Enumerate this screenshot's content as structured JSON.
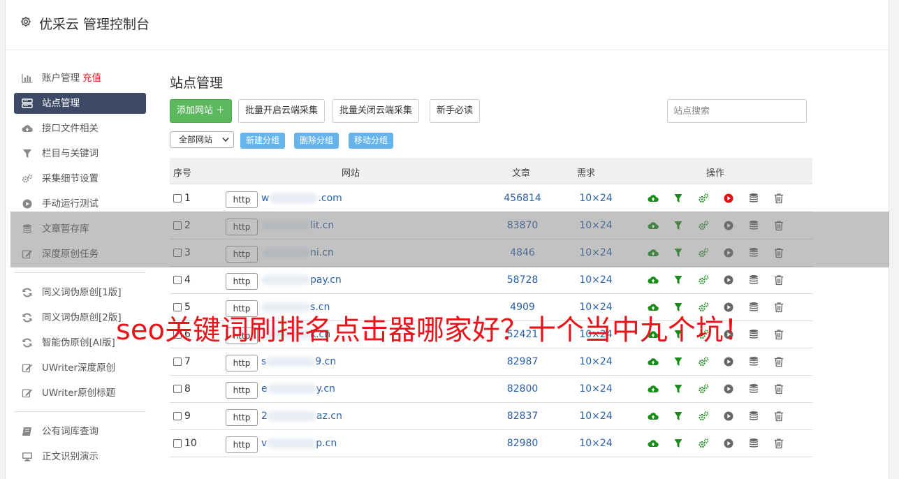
{
  "app": {
    "title": "优采云 管理控制台"
  },
  "sidebar": {
    "group1": [
      {
        "label": "账户管理",
        "extra": "充值",
        "icon": "bar-chart-icon"
      },
      {
        "label": "站点管理",
        "icon": "server-icon",
        "active": true
      },
      {
        "label": "接口文件相关",
        "icon": "cloud-upload-icon"
      },
      {
        "label": "栏目与关键词",
        "icon": "filter-icon"
      },
      {
        "label": "采集细节设置",
        "icon": "gears-icon"
      },
      {
        "label": "手动运行测试",
        "icon": "play-circle-icon"
      },
      {
        "label": "文章暂存库",
        "icon": "database-icon"
      },
      {
        "label": "深度原创任务",
        "icon": "edit-icon"
      }
    ],
    "group2": [
      {
        "label": "同义词伪原创[1版]",
        "icon": "refresh-icon"
      },
      {
        "label": "同义词伪原创[2版]",
        "icon": "refresh-icon"
      },
      {
        "label": "智能伪原创[AI版]",
        "icon": "refresh-icon"
      },
      {
        "label": "UWriter深度原创",
        "icon": "edit-icon"
      },
      {
        "label": "UWriter原创标题",
        "icon": "edit-icon"
      }
    ],
    "group3": [
      {
        "label": "公有词库查询",
        "icon": "book-icon"
      },
      {
        "label": "正文识别演示",
        "icon": "monitor-icon"
      }
    ]
  },
  "main": {
    "title": "站点管理",
    "buttons": {
      "add_site": "添加网站 ＋",
      "batch_open": "批量开启云端采集",
      "batch_close": "批量关闭云端采集",
      "guide": "新手必读"
    },
    "search_placeholder": "站点搜索",
    "group_select": "全部网站",
    "group_buttons": {
      "new": "新建分组",
      "delete": "删除分组",
      "move": "移动分组"
    },
    "table": {
      "headers": {
        "no": "序号",
        "site": "网站",
        "articles": "文章",
        "demand": "需求",
        "ops": "操作"
      },
      "rows": [
        {
          "no": "1",
          "scheme": "http",
          "pre": "w",
          "suf": ".com",
          "articles": "456814",
          "demand": "10×24",
          "play_red": true
        },
        {
          "no": "2",
          "scheme": "http",
          "pre": "",
          "suf": "lit.cn",
          "articles": "83870",
          "demand": "10×24"
        },
        {
          "no": "3",
          "scheme": "http",
          "pre": "",
          "suf": "ni.cn",
          "articles": "4846",
          "demand": "10×24"
        },
        {
          "no": "4",
          "scheme": "http",
          "pre": "",
          "suf": "pay.cn",
          "articles": "58728",
          "demand": "10×24"
        },
        {
          "no": "5",
          "scheme": "http",
          "pre": "",
          "suf": "s.cn",
          "articles": "4909",
          "demand": "10×24"
        },
        {
          "no": "6",
          "scheme": "http",
          "pre": "",
          "suf": "k.cn",
          "articles": "52421",
          "demand": "10×24"
        },
        {
          "no": "7",
          "scheme": "http",
          "pre": "s",
          "suf": "9.cn",
          "articles": "82987",
          "demand": "10×24"
        },
        {
          "no": "8",
          "scheme": "http",
          "pre": "e",
          "suf": "y.cn",
          "articles": "82800",
          "demand": "10×24"
        },
        {
          "no": "9",
          "scheme": "http",
          "pre": "2",
          "suf": "az.cn",
          "articles": "82837",
          "demand": "10×24"
        },
        {
          "no": "10",
          "scheme": "http",
          "pre": "v",
          "suf": "p.cn",
          "articles": "82980",
          "demand": "10×24"
        }
      ]
    }
  },
  "banner": "seo关键词刷排名点击器哪家好？十个当中九个坑！",
  "colors": {
    "sidebar_active": "#3d4a66",
    "green": "#5cb85c",
    "link": "#2a60a8",
    "banner": "#e8141a"
  }
}
